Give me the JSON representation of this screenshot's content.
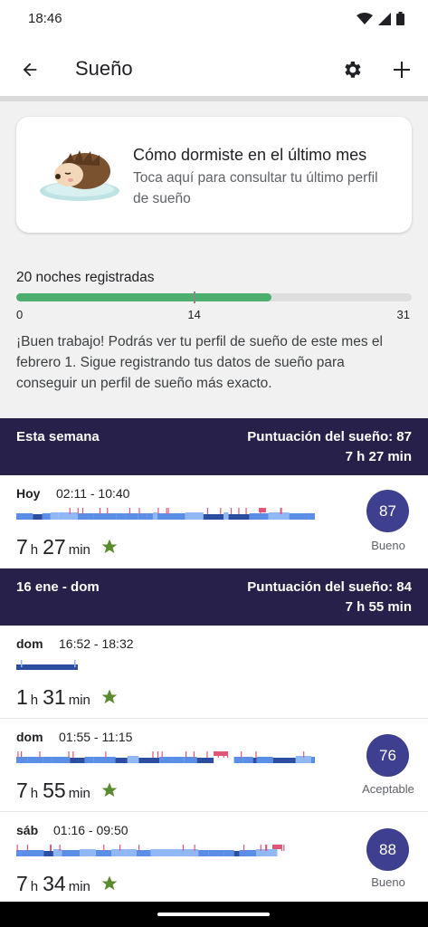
{
  "status_bar": {
    "time": "18:46",
    "icons": [
      "wifi-icon",
      "signal-icon",
      "battery-icon"
    ]
  },
  "app_bar": {
    "title": "Sueño",
    "back_icon": "arrow-back-icon",
    "settings_icon": "gear-icon",
    "add_icon": "plus-icon"
  },
  "profile_card": {
    "title": "Cómo dormiste en el último mes",
    "subtitle": "Toca aquí para consultar tu último perfil de sueño"
  },
  "progress": {
    "label": "20 noches registradas",
    "value": 20,
    "max": 31,
    "marker": 14,
    "ticks": [
      "0",
      "14",
      "31"
    ],
    "fill_color": "#4caf6d"
  },
  "info_text": "¡Buen trabajo! Podrás ver tu perfil de sueño de este mes el febrero 1. Sigue registrando tus datos de sueño para conseguir un perfil de sueño más exacto.",
  "weeks": [
    {
      "label": "Esta semana",
      "score_text": "Puntuación del sueño: 87",
      "duration_text": "7 h 27 min",
      "entries": [
        {
          "day": "Hoy",
          "time_range": "02:11 - 10:40",
          "hours": "7",
          "h_unit": "h",
          "minutes": "27",
          "m_unit": "min",
          "score": "87",
          "rating": "Bueno",
          "star": true
        }
      ]
    },
    {
      "label": "16 ene - dom",
      "score_text": "Puntuación del sueño: 84",
      "duration_text": "7 h 55 min",
      "entries": [
        {
          "day": "dom",
          "time_range": "16:52 - 18:32",
          "hours": "1",
          "h_unit": "h",
          "minutes": "31",
          "m_unit": "min",
          "star": true
        },
        {
          "day": "dom",
          "time_range": "01:55 - 11:15",
          "hours": "7",
          "h_unit": "h",
          "minutes": "55",
          "m_unit": "min",
          "score": "76",
          "rating": "Aceptable",
          "star": true
        },
        {
          "day": "sáb",
          "time_range": "01:16 - 09:50",
          "hours": "7",
          "h_unit": "h",
          "minutes": "34",
          "m_unit": "min",
          "score": "88",
          "rating": "Bueno",
          "star": true
        }
      ]
    }
  ],
  "colors": {
    "header_bg": "#26204a",
    "score_circle": "#3f3f8f",
    "star": "#5a8a2e",
    "deep": "#2b4ea0",
    "light": "#5b8ee6",
    "rem": "#8fb8f5",
    "awake": "#e05578"
  }
}
